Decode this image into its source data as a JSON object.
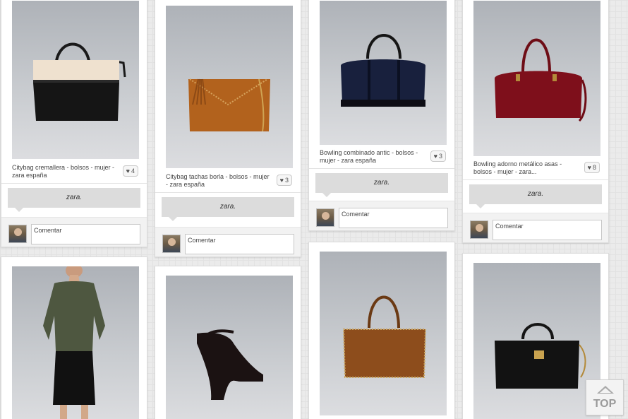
{
  "pins": [
    {
      "description": "Citybag cremallera - bolsos - mujer - zara españa",
      "likes": "4",
      "source": "zara.",
      "comment_placeholder": "Comentar",
      "image": "black-cream-tote-bag"
    },
    {
      "description": "Citybag tachas borla - bolsos - mujer - zara españa",
      "likes": "3",
      "source": "zara.",
      "comment_placeholder": "Comentar",
      "image": "tan-studded-clutch-with-tassel"
    },
    {
      "description": "Bowling combinado antic - bolsos - mujer - zara españa",
      "likes": "3",
      "source": "zara.",
      "comment_placeholder": "Comentar",
      "image": "navy-bowling-bag"
    },
    {
      "description": "Bowling adorno metálico asas - bolsos - mujer - zara...",
      "likes": "8",
      "source": "zara.",
      "comment_placeholder": "Comentar",
      "image": "burgundy-bowling-bag"
    },
    {
      "image": "model-green-sweater-black-skirt"
    },
    {
      "image": "black-platform-wedge-shoe"
    },
    {
      "image": "cognac-studded-tote"
    },
    {
      "image": "black-structured-handbag"
    }
  ],
  "top_button": {
    "label": "TOP"
  },
  "colors": {
    "like_heart": "#555555",
    "source_bubble": "#dcdcdc",
    "background": "#ebebeb"
  }
}
